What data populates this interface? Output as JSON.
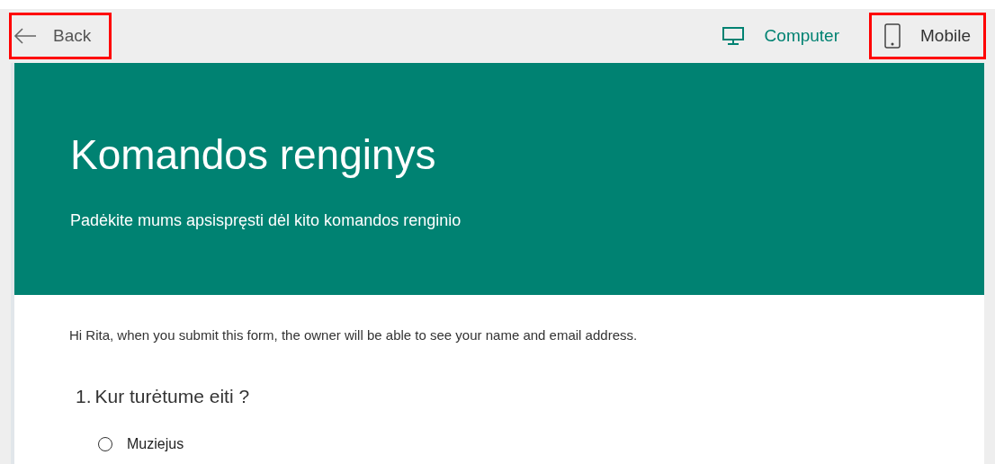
{
  "toolbar": {
    "back": {
      "label": "Back",
      "highlighted": true
    },
    "views": [
      {
        "kind": "computer",
        "label": "Computer",
        "selected": true,
        "highlighted": false
      },
      {
        "kind": "mobile",
        "label": "Mobile",
        "selected": false,
        "highlighted": true
      }
    ]
  },
  "form": {
    "title": "Komandos renginys",
    "subtitle": "Padėkite mums apsispręsti dėl kito komandos renginio",
    "notice": "Hi Rita, when you submit this form, the owner will be able to see your name and email address.",
    "questions": [
      {
        "number": "1.",
        "text": "Kur turėtume eiti ?",
        "options": [
          {
            "label": "Muziejus",
            "selected": false
          }
        ]
      }
    ]
  }
}
